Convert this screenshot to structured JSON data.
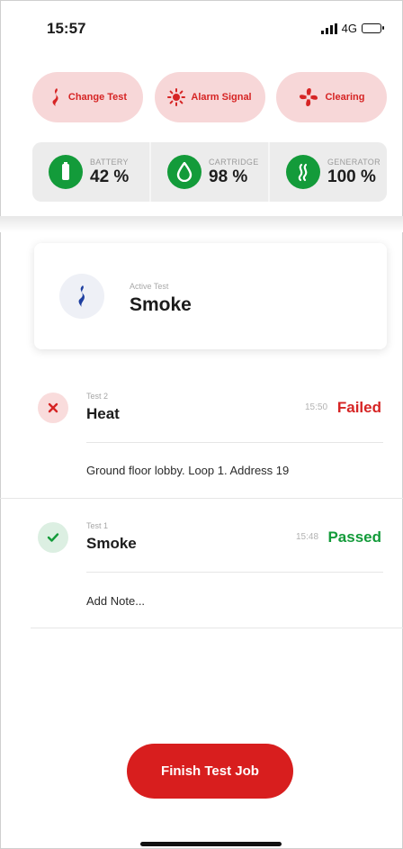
{
  "status_bar": {
    "time": "15:57",
    "network": "4G"
  },
  "quick_actions": [
    {
      "label": "Change Test",
      "icon": "smoke-test-icon"
    },
    {
      "label": "Alarm Signal",
      "icon": "alarm-sun-icon"
    },
    {
      "label": "Clearing",
      "icon": "fan-icon"
    }
  ],
  "stats": [
    {
      "label": "BATTERY",
      "value": "42 %",
      "icon": "battery-icon"
    },
    {
      "label": "CARTRIDGE",
      "value": "98 %",
      "icon": "drop-icon"
    },
    {
      "label": "GENERATOR",
      "value": "100 %",
      "icon": "generator-icon"
    }
  ],
  "active_test": {
    "label": "Active Test",
    "name": "Smoke",
    "icon": "smoke-icon"
  },
  "tests": [
    {
      "number": "Test 2",
      "name": "Heat",
      "time": "15:50",
      "result": "Failed",
      "note": "Ground floor lobby. Loop 1. Address 19",
      "status_icon": "close-icon"
    },
    {
      "number": "Test 1",
      "name": "Smoke",
      "time": "15:48",
      "result": "Passed",
      "note": "Add Note...",
      "status_icon": "check-icon"
    }
  ],
  "finish_button": {
    "label": "Finish Test Job"
  },
  "colors": {
    "accent_red": "#d81e1e",
    "pill_bg": "#f7d7d8",
    "ok_green": "#139b3a",
    "active_blue": "#1e3fa0"
  }
}
